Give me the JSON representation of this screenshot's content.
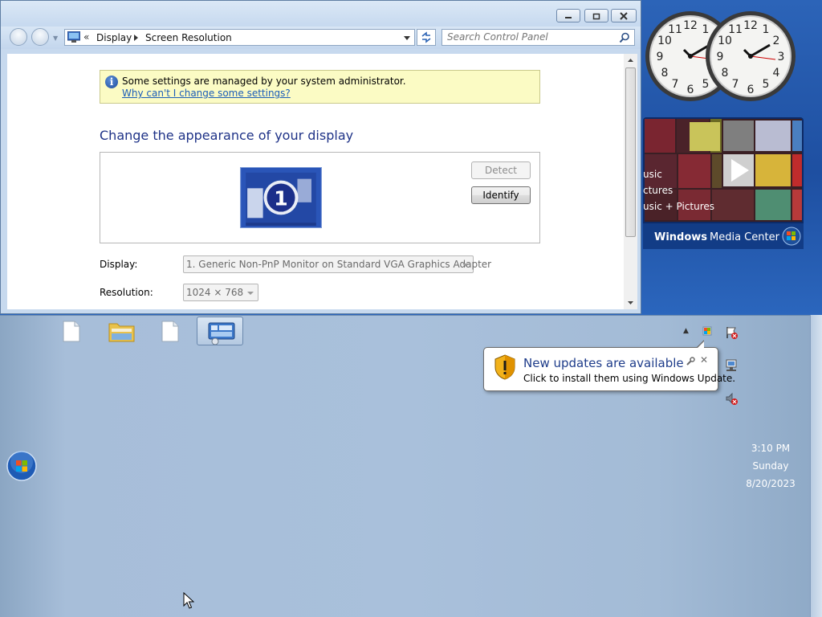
{
  "window": {
    "address": {
      "overflow_glyph": "«",
      "crumbs": [
        "Display",
        "Screen Resolution"
      ]
    },
    "search": {
      "placeholder": "Search Control Panel"
    },
    "info_bar": {
      "message": "Some settings are managed by your system administrator.",
      "link": "Why can't I change some settings?"
    },
    "heading": "Change the appearance of your display",
    "monitor_number": "1",
    "buttons": {
      "detect": "Detect",
      "identify": "Identify"
    },
    "display_label": "Display:",
    "display_value": "1. Generic Non-PnP Monitor on Standard VGA Graphics Adapter",
    "resolution_label": "Resolution:",
    "resolution_value": "1024 × 768"
  },
  "gadgets": {
    "clock_numbers": {
      "n12": "12",
      "n1": "1",
      "n2": "2",
      "n3": "3",
      "n4": "4",
      "n5": "5",
      "n6": "6",
      "n7": "7",
      "n8": "8",
      "n9": "9",
      "n10": "10",
      "n11": "11"
    },
    "media_center": {
      "menu": [
        "usic",
        "ctures",
        "usic + Pictures"
      ],
      "title_bold": "Windows",
      "title_rest": " Media Center"
    }
  },
  "taskbar": {
    "time": "3:10 PM",
    "day": "Sunday",
    "date": "8/20/2023",
    "tray_overflow_glyph": "▲"
  },
  "notification": {
    "title": "New updates are available",
    "body": "Click to install them using Windows Update.",
    "close_glyph": "✕"
  },
  "colors": {
    "heading": "#1e3287",
    "link": "#1a5cb8",
    "info_background": "#fbfbc4",
    "taskbar": "#a9c0db",
    "desktop": "#1e4fa1"
  }
}
